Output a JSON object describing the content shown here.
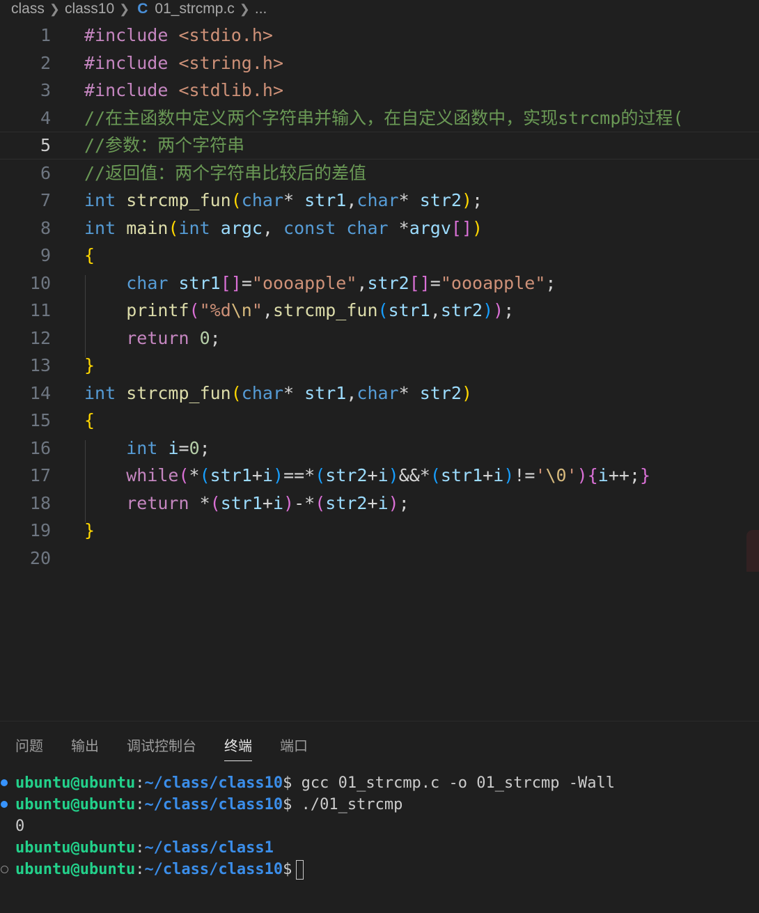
{
  "breadcrumb": {
    "items": [
      "class",
      "class10",
      "01_strcmp.c",
      "..."
    ],
    "file_icon": "C"
  },
  "editor": {
    "current_line": 5,
    "lines": [
      {
        "n": "1",
        "tokens": [
          {
            "c": "t-dir",
            "t": "#include"
          },
          {
            "c": "t-op",
            "t": " "
          },
          {
            "c": "t-inc",
            "t": "<stdio.h>"
          }
        ]
      },
      {
        "n": "2",
        "tokens": [
          {
            "c": "t-dir",
            "t": "#include"
          },
          {
            "c": "t-op",
            "t": " "
          },
          {
            "c": "t-inc",
            "t": "<string.h>"
          }
        ]
      },
      {
        "n": "3",
        "tokens": [
          {
            "c": "t-dir",
            "t": "#include"
          },
          {
            "c": "t-op",
            "t": " "
          },
          {
            "c": "t-inc",
            "t": "<stdlib.h>"
          }
        ]
      },
      {
        "n": "4",
        "tokens": [
          {
            "c": "t-com",
            "t": "//在主函数中定义两个字符串并输入，在自定义函数中，实现strcmp的过程("
          }
        ]
      },
      {
        "n": "5",
        "tokens": [
          {
            "c": "t-com",
            "t": "//参数：两个字符串"
          }
        ]
      },
      {
        "n": "6",
        "tokens": [
          {
            "c": "t-com",
            "t": "//返回值：两个字符串比较后的差值"
          }
        ]
      },
      {
        "n": "7",
        "tokens": [
          {
            "c": "t-kw",
            "t": "int"
          },
          {
            "c": "t-op",
            "t": " "
          },
          {
            "c": "t-fn",
            "t": "strcmp_fun"
          },
          {
            "c": "t-b1",
            "t": "("
          },
          {
            "c": "t-kw",
            "t": "char"
          },
          {
            "c": "t-op",
            "t": "* "
          },
          {
            "c": "t-var",
            "t": "str1"
          },
          {
            "c": "t-op",
            "t": ","
          },
          {
            "c": "t-kw",
            "t": "char"
          },
          {
            "c": "t-op",
            "t": "* "
          },
          {
            "c": "t-var",
            "t": "str2"
          },
          {
            "c": "t-b1",
            "t": ")"
          },
          {
            "c": "t-op",
            "t": ";"
          }
        ]
      },
      {
        "n": "8",
        "tokens": [
          {
            "c": "t-kw",
            "t": "int"
          },
          {
            "c": "t-op",
            "t": " "
          },
          {
            "c": "t-fn",
            "t": "main"
          },
          {
            "c": "t-b1",
            "t": "("
          },
          {
            "c": "t-kw",
            "t": "int"
          },
          {
            "c": "t-op",
            "t": " "
          },
          {
            "c": "t-var",
            "t": "argc"
          },
          {
            "c": "t-op",
            "t": ", "
          },
          {
            "c": "t-kw",
            "t": "const"
          },
          {
            "c": "t-op",
            "t": " "
          },
          {
            "c": "t-kw",
            "t": "char"
          },
          {
            "c": "t-op",
            "t": " *"
          },
          {
            "c": "t-var",
            "t": "argv"
          },
          {
            "c": "t-b2",
            "t": "[]"
          },
          {
            "c": "t-b1",
            "t": ")"
          }
        ]
      },
      {
        "n": "9",
        "tokens": [
          {
            "c": "t-b1",
            "t": "{"
          }
        ]
      },
      {
        "n": "10",
        "tokens": [
          {
            "c": "t-op",
            "t": "    "
          },
          {
            "c": "t-kw",
            "t": "char"
          },
          {
            "c": "t-op",
            "t": " "
          },
          {
            "c": "t-var",
            "t": "str1"
          },
          {
            "c": "t-b2",
            "t": "[]"
          },
          {
            "c": "t-op",
            "t": "="
          },
          {
            "c": "t-str",
            "t": "\"oooapple\""
          },
          {
            "c": "t-op",
            "t": ","
          },
          {
            "c": "t-var",
            "t": "str2"
          },
          {
            "c": "t-b2",
            "t": "[]"
          },
          {
            "c": "t-op",
            "t": "="
          },
          {
            "c": "t-str",
            "t": "\"oooapple\""
          },
          {
            "c": "t-op",
            "t": ";"
          }
        ]
      },
      {
        "n": "11",
        "tokens": [
          {
            "c": "t-op",
            "t": "    "
          },
          {
            "c": "t-fn",
            "t": "printf"
          },
          {
            "c": "t-b2",
            "t": "("
          },
          {
            "c": "t-str",
            "t": "\"%d"
          },
          {
            "c": "t-esc",
            "t": "\\n"
          },
          {
            "c": "t-str",
            "t": "\""
          },
          {
            "c": "t-op",
            "t": ","
          },
          {
            "c": "t-fn",
            "t": "strcmp_fun"
          },
          {
            "c": "t-b3",
            "t": "("
          },
          {
            "c": "t-var",
            "t": "str1"
          },
          {
            "c": "t-op",
            "t": ","
          },
          {
            "c": "t-var",
            "t": "str2"
          },
          {
            "c": "t-b3",
            "t": ")"
          },
          {
            "c": "t-b2",
            "t": ")"
          },
          {
            "c": "t-op",
            "t": ";"
          }
        ]
      },
      {
        "n": "12",
        "tokens": [
          {
            "c": "t-op",
            "t": "    "
          },
          {
            "c": "t-ctl",
            "t": "return"
          },
          {
            "c": "t-op",
            "t": " "
          },
          {
            "c": "t-num",
            "t": "0"
          },
          {
            "c": "t-op",
            "t": ";"
          }
        ]
      },
      {
        "n": "13",
        "tokens": [
          {
            "c": "t-b1",
            "t": "}"
          }
        ]
      },
      {
        "n": "14",
        "tokens": [
          {
            "c": "t-kw",
            "t": "int"
          },
          {
            "c": "t-op",
            "t": " "
          },
          {
            "c": "t-fn",
            "t": "strcmp_fun"
          },
          {
            "c": "t-b1",
            "t": "("
          },
          {
            "c": "t-kw",
            "t": "char"
          },
          {
            "c": "t-op",
            "t": "* "
          },
          {
            "c": "t-var",
            "t": "str1"
          },
          {
            "c": "t-op",
            "t": ","
          },
          {
            "c": "t-kw",
            "t": "char"
          },
          {
            "c": "t-op",
            "t": "* "
          },
          {
            "c": "t-var",
            "t": "str2"
          },
          {
            "c": "t-b1",
            "t": ")"
          }
        ]
      },
      {
        "n": "15",
        "tokens": [
          {
            "c": "t-b1",
            "t": "{"
          }
        ]
      },
      {
        "n": "16",
        "tokens": [
          {
            "c": "t-op",
            "t": "    "
          },
          {
            "c": "t-kw",
            "t": "int"
          },
          {
            "c": "t-op",
            "t": " "
          },
          {
            "c": "t-var",
            "t": "i"
          },
          {
            "c": "t-op",
            "t": "="
          },
          {
            "c": "t-num",
            "t": "0"
          },
          {
            "c": "t-op",
            "t": ";"
          }
        ]
      },
      {
        "n": "17",
        "tokens": [
          {
            "c": "t-op",
            "t": "    "
          },
          {
            "c": "t-ctl",
            "t": "while"
          },
          {
            "c": "t-b2",
            "t": "("
          },
          {
            "c": "t-op",
            "t": "*"
          },
          {
            "c": "t-b3",
            "t": "("
          },
          {
            "c": "t-var",
            "t": "str1"
          },
          {
            "c": "t-op",
            "t": "+"
          },
          {
            "c": "t-var",
            "t": "i"
          },
          {
            "c": "t-b3",
            "t": ")"
          },
          {
            "c": "t-op",
            "t": "==*"
          },
          {
            "c": "t-b3",
            "t": "("
          },
          {
            "c": "t-var",
            "t": "str2"
          },
          {
            "c": "t-op",
            "t": "+"
          },
          {
            "c": "t-var",
            "t": "i"
          },
          {
            "c": "t-b3",
            "t": ")"
          },
          {
            "c": "t-op",
            "t": "&&*"
          },
          {
            "c": "t-b3",
            "t": "("
          },
          {
            "c": "t-var",
            "t": "str1"
          },
          {
            "c": "t-op",
            "t": "+"
          },
          {
            "c": "t-var",
            "t": "i"
          },
          {
            "c": "t-b3",
            "t": ")"
          },
          {
            "c": "t-op",
            "t": "!="
          },
          {
            "c": "t-str",
            "t": "'"
          },
          {
            "c": "t-esc",
            "t": "\\0"
          },
          {
            "c": "t-str",
            "t": "'"
          },
          {
            "c": "t-b2",
            "t": ")"
          },
          {
            "c": "t-b2",
            "t": "{"
          },
          {
            "c": "t-var",
            "t": "i"
          },
          {
            "c": "t-op",
            "t": "++;"
          },
          {
            "c": "t-b2",
            "t": "}"
          }
        ]
      },
      {
        "n": "18",
        "tokens": [
          {
            "c": "t-op",
            "t": "    "
          },
          {
            "c": "t-ctl",
            "t": "return"
          },
          {
            "c": "t-op",
            "t": " *"
          },
          {
            "c": "t-b2",
            "t": "("
          },
          {
            "c": "t-var",
            "t": "str1"
          },
          {
            "c": "t-op",
            "t": "+"
          },
          {
            "c": "t-var",
            "t": "i"
          },
          {
            "c": "t-b2",
            "t": ")"
          },
          {
            "c": "t-op",
            "t": "-*"
          },
          {
            "c": "t-b2",
            "t": "("
          },
          {
            "c": "t-var",
            "t": "str2"
          },
          {
            "c": "t-op",
            "t": "+"
          },
          {
            "c": "t-var",
            "t": "i"
          },
          {
            "c": "t-b2",
            "t": ")"
          },
          {
            "c": "t-op",
            "t": ";"
          }
        ]
      },
      {
        "n": "19",
        "tokens": [
          {
            "c": "t-b1",
            "t": "}"
          }
        ]
      },
      {
        "n": "20",
        "tokens": []
      }
    ]
  },
  "panel": {
    "tabs": [
      "问题",
      "输出",
      "调试控制台",
      "终端",
      "端口"
    ],
    "active_tab": "终端"
  },
  "terminal": {
    "lines": [
      {
        "dot": "filled",
        "user": "ubuntu@ubuntu",
        "path": "~/class/class10",
        "sym": "$",
        "cmd": " gcc 01_strcmp.c -o 01_strcmp -Wall"
      },
      {
        "dot": "filled",
        "user": "ubuntu@ubuntu",
        "path": "~/class/class10",
        "sym": "$",
        "cmd": " ./01_strcmp"
      },
      {
        "output": "0"
      },
      {
        "user": "ubuntu@ubuntu",
        "path": "~/class/class1"
      },
      {
        "dot": "hollow",
        "user": "ubuntu@ubuntu",
        "path": "~/class/class10",
        "sym": "$",
        "cmd": "",
        "cursor": true
      }
    ]
  }
}
